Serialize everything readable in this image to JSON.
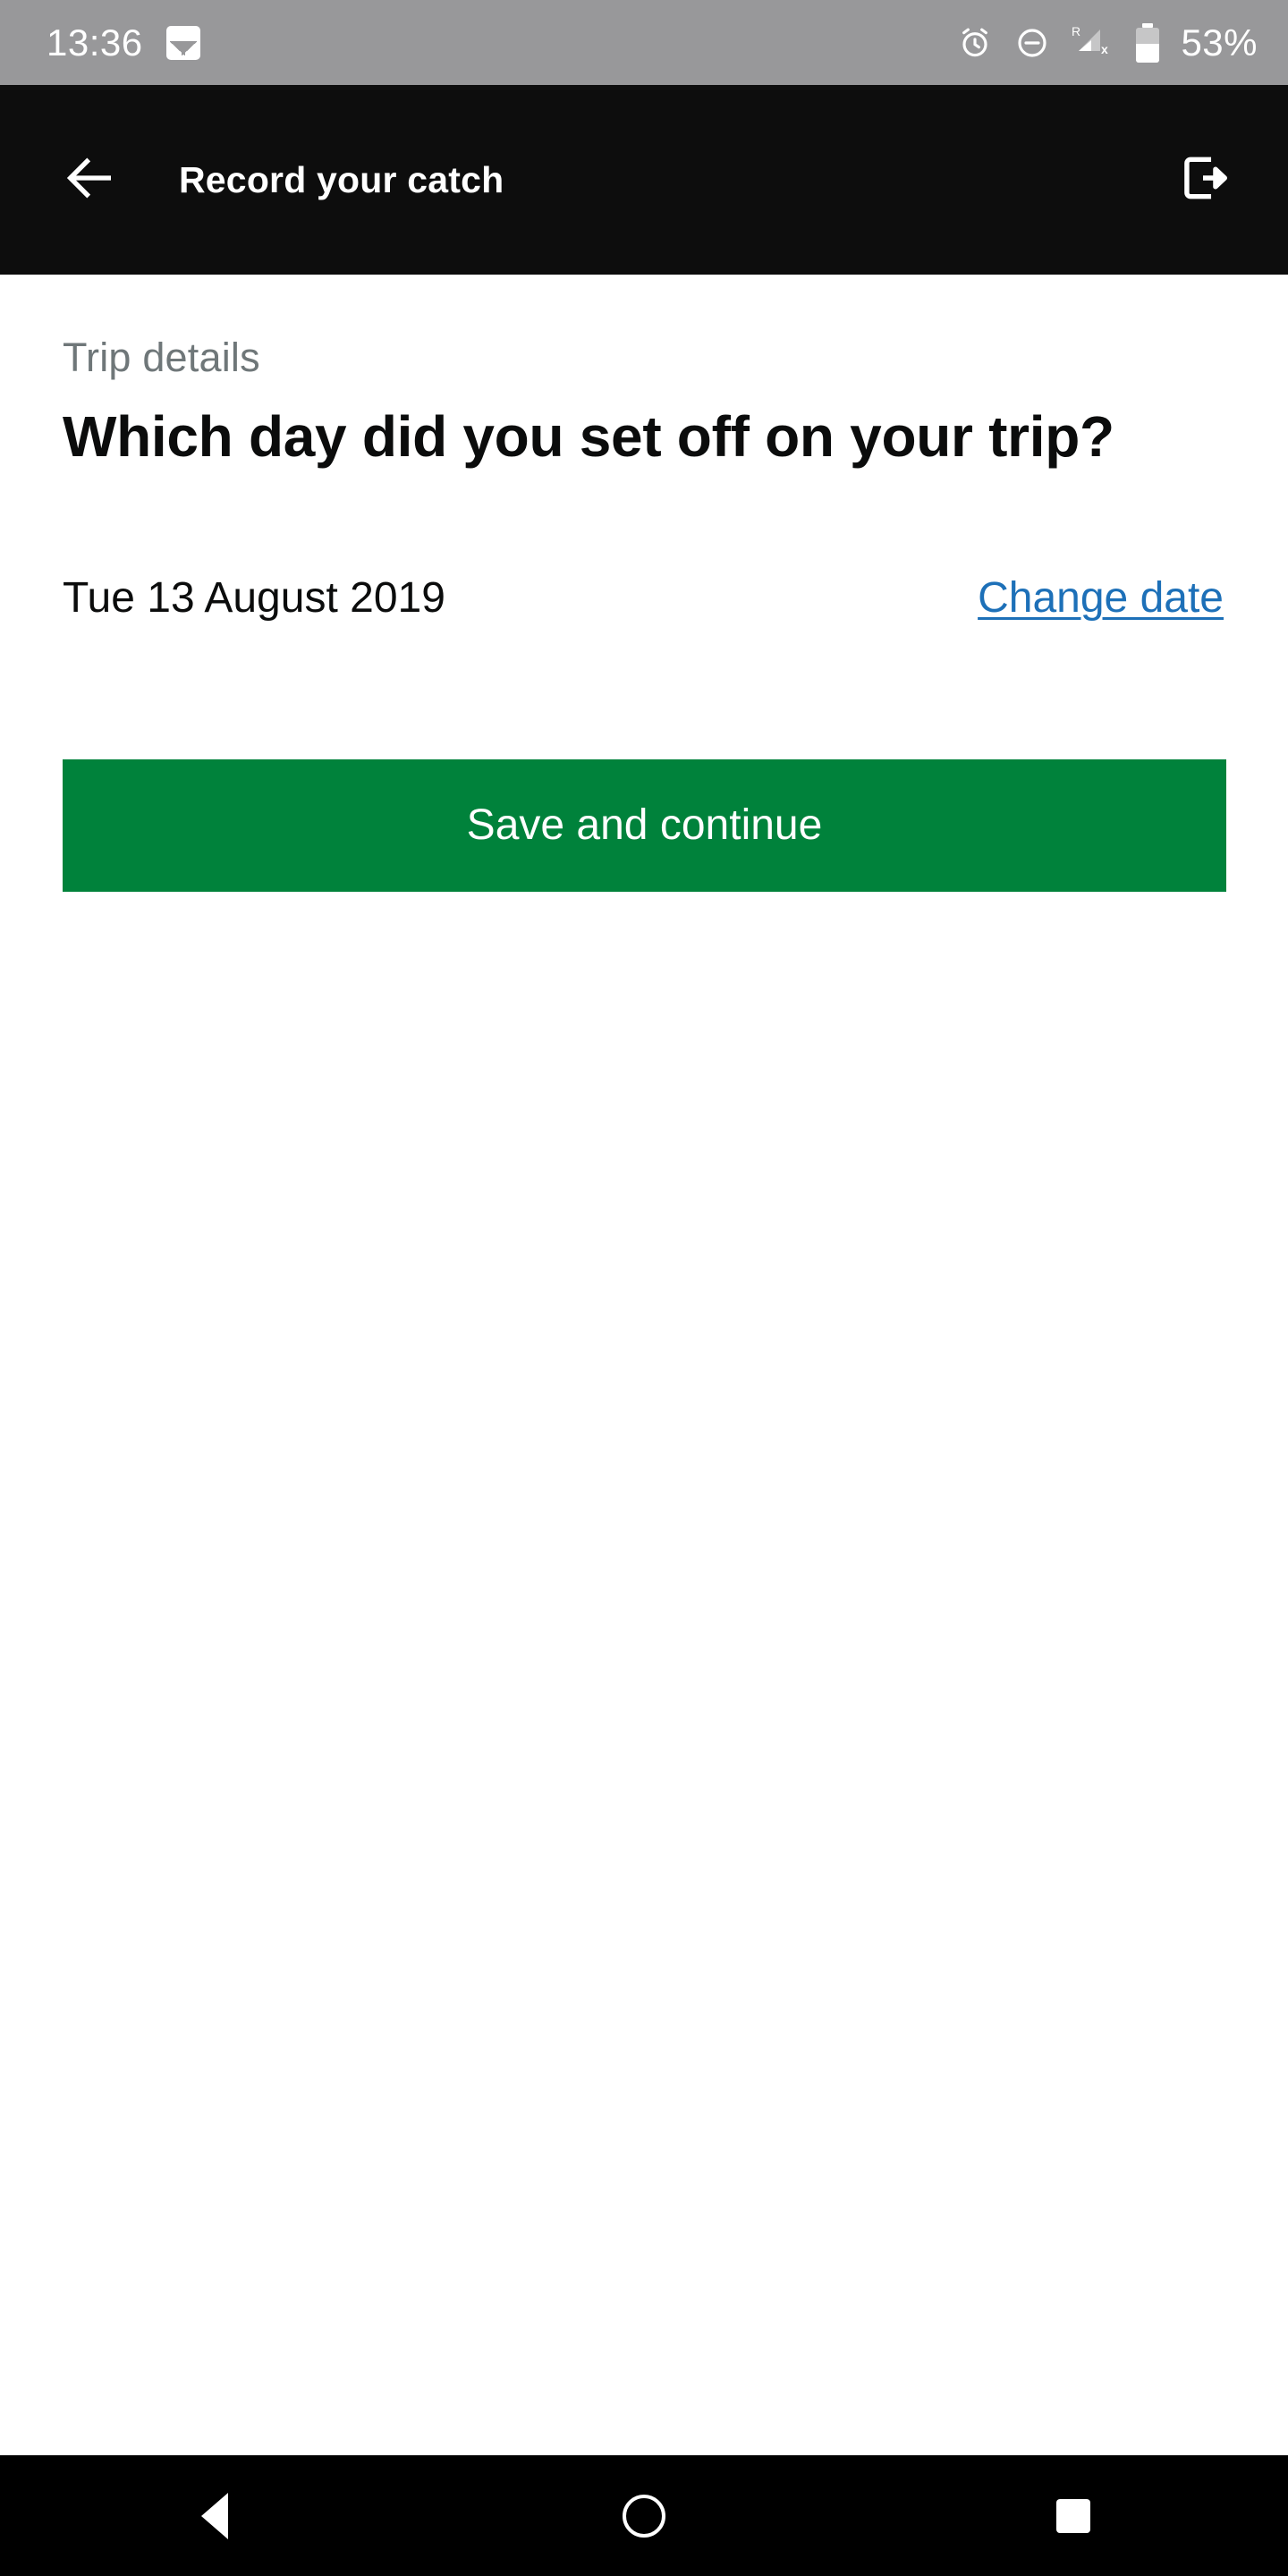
{
  "status_bar": {
    "time": "13:36",
    "battery_text": "53%",
    "battery_level_percent": 53,
    "background_color": "#98989a",
    "icons": [
      {
        "name": "photo-icon",
        "label": "photo"
      },
      {
        "name": "alarm-icon",
        "label": "alarm"
      },
      {
        "name": "do-not-disturb-icon",
        "label": "do not disturb"
      },
      {
        "name": "signal-roaming-no-service-icon",
        "label": "R"
      },
      {
        "name": "battery-icon",
        "label": "battery"
      }
    ]
  },
  "app_bar": {
    "title": "Record your catch",
    "back_icon": "back-arrow-icon",
    "exit_icon": "sign-out-icon",
    "background_color": "#0d0d0d"
  },
  "main": {
    "caption": "Trip details",
    "heading": "Which day did you set off on your trip?",
    "date_value": "Tue 13 August 2019",
    "change_link": "Change date",
    "submit_label": "Save and continue",
    "link_color": "#1d70b8",
    "button_color": "#00823b",
    "caption_color": "#6f7779"
  },
  "nav_bar": {
    "back": "back",
    "home": "home",
    "recents": "recents",
    "background_color": "#000000"
  }
}
